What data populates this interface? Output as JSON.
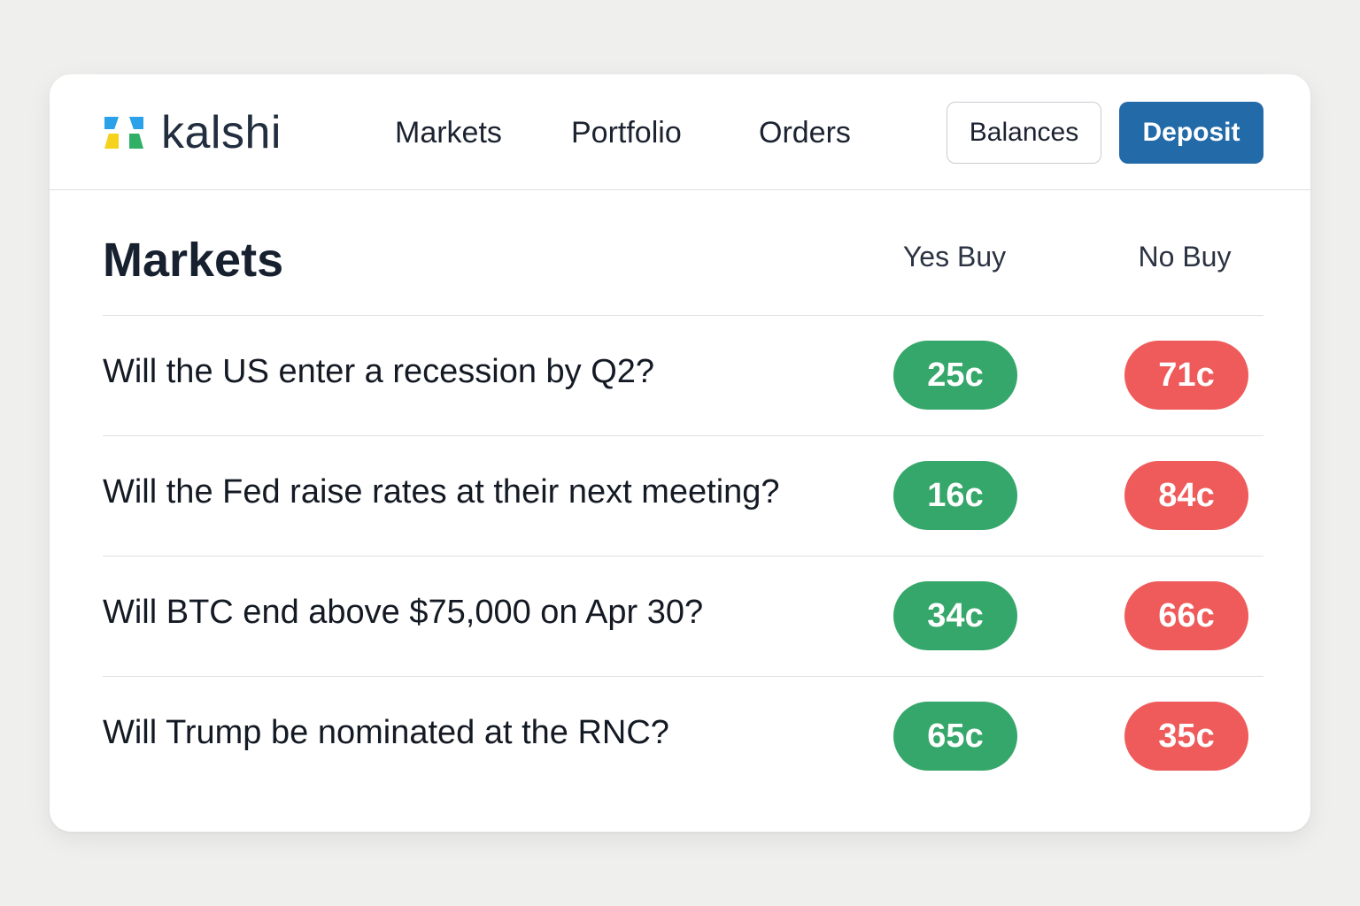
{
  "brand": {
    "name": "kalshi"
  },
  "nav": {
    "items": [
      {
        "label": "Markets"
      },
      {
        "label": "Portfolio"
      },
      {
        "label": "Orders"
      }
    ]
  },
  "actions": {
    "balances_label": "Balances",
    "deposit_label": "Deposit"
  },
  "main": {
    "title": "Markets",
    "columns": {
      "yes": "Yes Buy",
      "no": "No Buy"
    },
    "markets": [
      {
        "question": "Will the US enter a recession by Q2?",
        "yes": "25c",
        "no": "71c"
      },
      {
        "question": "Will the Fed raise rates at their next meeting?",
        "yes": "16c",
        "no": "84c"
      },
      {
        "question": "Will BTC end above $75,000 on Apr 30?",
        "yes": "34c",
        "no": "66c"
      },
      {
        "question": "Will Trump be nominated at the RNC?",
        "yes": "65c",
        "no": "35c"
      }
    ]
  },
  "colors": {
    "yes": "#36a76a",
    "no": "#ef5a5a",
    "deposit": "#236aa8",
    "logo_blue": "#2aa1e8",
    "logo_yellow": "#f5d21b",
    "logo_green": "#2fb066"
  }
}
